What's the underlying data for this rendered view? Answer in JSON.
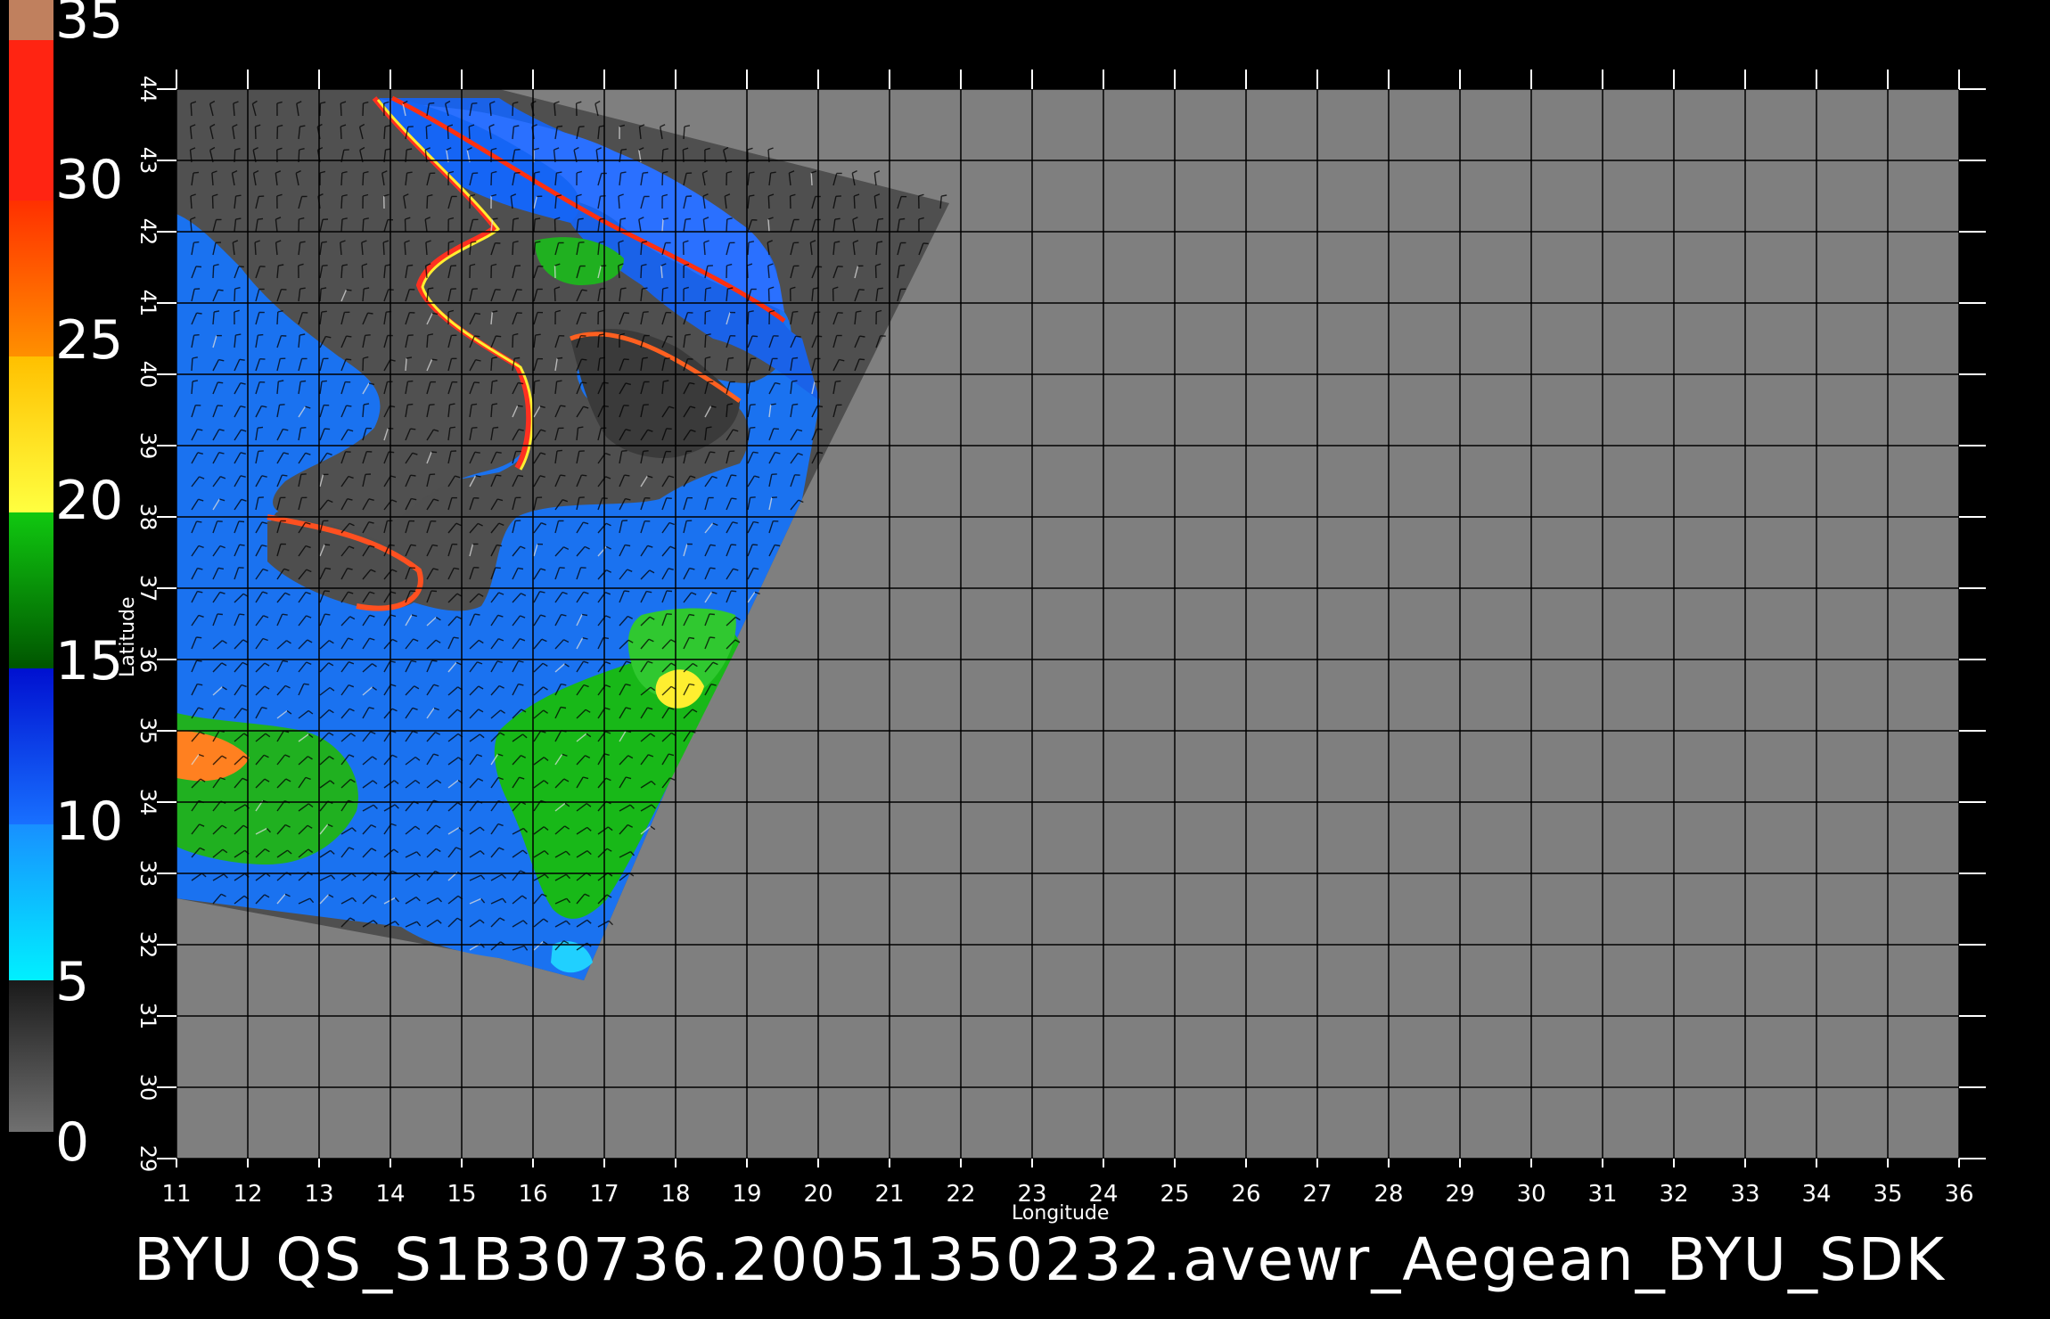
{
  "caption": "BYU  QS_S1B30736.20051350232.avewr_Aegean_BYU_SDK",
  "x_axis": {
    "title": "Longitude",
    "ticks": [
      "11",
      "12",
      "13",
      "14",
      "15",
      "16",
      "17",
      "18",
      "19",
      "20",
      "21",
      "22",
      "23",
      "24",
      "25",
      "26",
      "27",
      "28",
      "29",
      "30",
      "31",
      "32",
      "33",
      "34",
      "35",
      "36"
    ]
  },
  "y_axis": {
    "title": "Latitude",
    "ticks": [
      "29",
      "30",
      "31",
      "32",
      "33",
      "34",
      "35",
      "36",
      "37",
      "38",
      "39",
      "40",
      "41",
      "42",
      "43",
      "44"
    ]
  },
  "color_scale": {
    "labels": [
      "0",
      "5",
      "10",
      "15",
      "20",
      "25",
      "30",
      "35"
    ],
    "segments": [
      "#707070",
      "#4a4a4a",
      "#00eeff",
      "#1080ff",
      "#0020dd",
      "#006000",
      "#10c010",
      "#ffff30",
      "#ffd000",
      "#ff8000",
      "#ff4000",
      "#ff2010",
      "#c08060"
    ]
  },
  "colors": {
    "background": "#000000",
    "map_fill": "#7f7f7f",
    "swath_fill": "#4f4f4f",
    "grid": "#000000"
  }
}
